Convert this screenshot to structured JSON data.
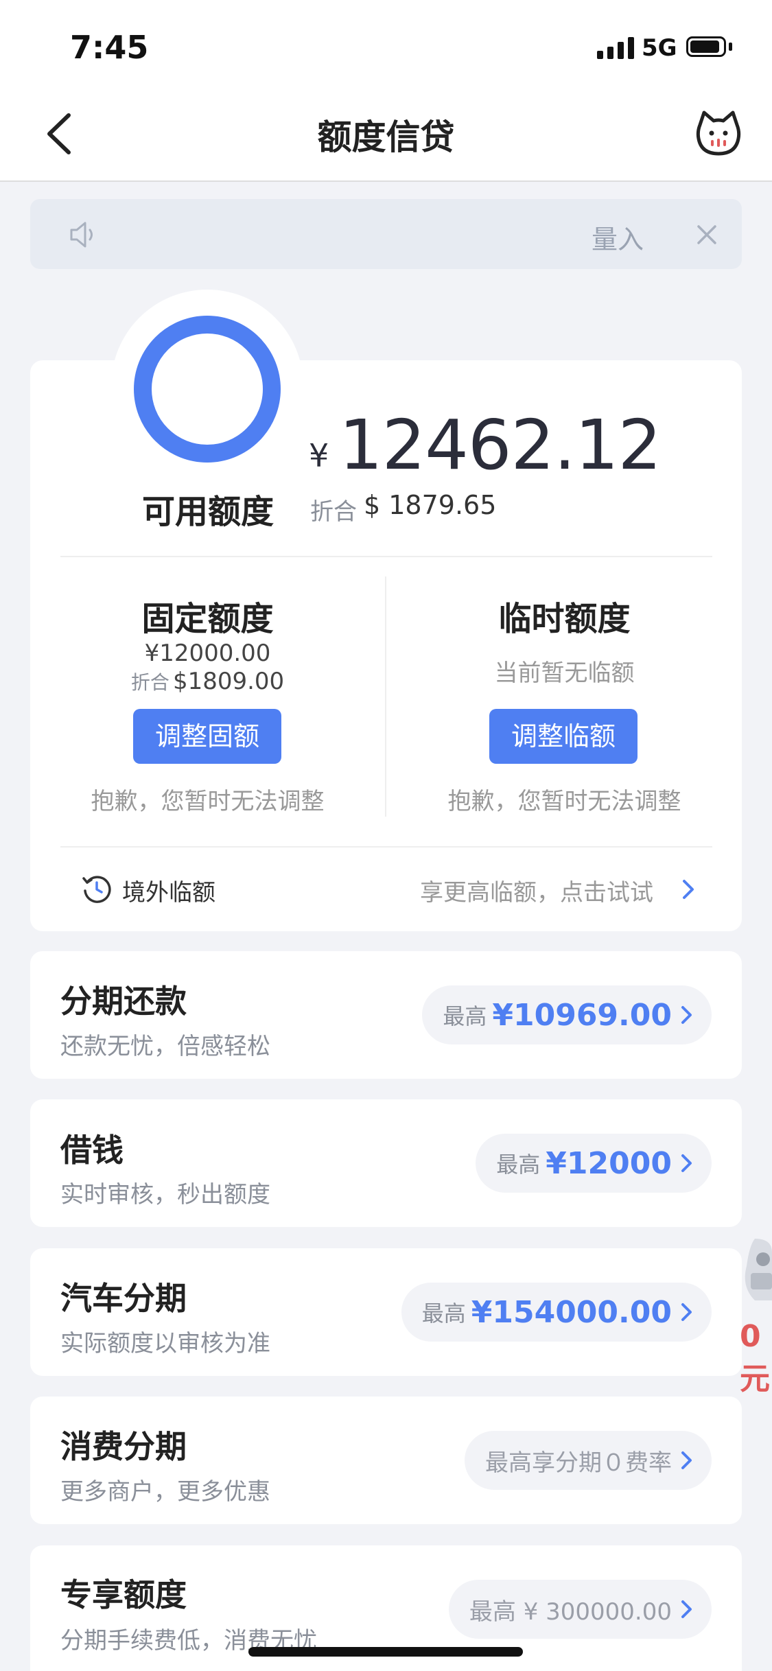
{
  "status_bar": {
    "time": "7:45",
    "network": "5G"
  },
  "header": {
    "title": "额度信贷"
  },
  "notice": {
    "text": "量入"
  },
  "credit": {
    "available_label": "可用额度",
    "currency_symbol": "¥",
    "available_amount": "12462.12",
    "converted_label": "折合",
    "converted_value": "$ 1879.65",
    "fixed": {
      "title": "固定额度",
      "amount": "¥12000.00",
      "converted_label": "折合",
      "converted_value": "$1809.00",
      "button": "调整固额",
      "note": "抱歉，您暂时无法调整"
    },
    "temporary": {
      "title": "临时额度",
      "status": "当前暂无临额",
      "button": "调整临额",
      "note": "抱歉，您暂时无法调整"
    },
    "overseas": {
      "label": "境外临额",
      "promo": "享更高临额，点击试试"
    }
  },
  "products": [
    {
      "title": "分期还款",
      "subtitle": "还款无忧，倍感轻松",
      "pill_label": "最高",
      "pill_value": "¥10969.00"
    },
    {
      "title": "借钱",
      "subtitle": "实时审核，秒出额度",
      "pill_label": "最高",
      "pill_value": "¥12000"
    },
    {
      "title": "汽车分期",
      "subtitle": "实际额度以审核为准",
      "pill_label": "最高",
      "pill_value": "¥154000.00"
    },
    {
      "title": "消费分期",
      "subtitle": "更多商户，更多优惠",
      "pill_text": "最高享分期０费率"
    },
    {
      "title": "专享额度",
      "subtitle": "分期手续费低，消费无忧",
      "pill_text": "最高 ¥ 300000.00"
    }
  ],
  "side_banner": {
    "text": "0元"
  },
  "colors": {
    "accent": "#4f7ff2",
    "background": "#f2f3f7",
    "promo_red": "#e05a5a"
  },
  "icons": [
    "back-arrow-icon",
    "cat-mascot-icon",
    "speaker-icon",
    "close-icon",
    "history-icon",
    "chevron-right-icon"
  ]
}
